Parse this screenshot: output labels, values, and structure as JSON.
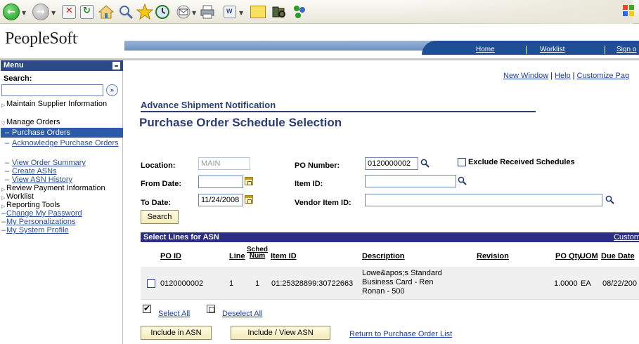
{
  "header": {
    "logo": "PeopleSoft",
    "logo_mark": ".",
    "links": [
      "Home",
      "Worklist",
      "Sign o"
    ]
  },
  "menu": {
    "title": "Menu",
    "search_label": "Search:",
    "search_go": "»",
    "items": [
      {
        "label": "Maintain Supplier Information",
        "type": "folder-collapsed"
      },
      {
        "label": "Manage Orders",
        "type": "folder-expanded"
      },
      {
        "label": "Purchase Orders",
        "type": "sub-active"
      },
      {
        "label": "Acknowledge Purchase Orders",
        "type": "sub"
      },
      {
        "label": "View Order Summary",
        "type": "sub"
      },
      {
        "label": "Create ASNs",
        "type": "sub"
      },
      {
        "label": "View ASN History",
        "type": "sub"
      },
      {
        "label": "Review Payment Information",
        "type": "folder-collapsed"
      },
      {
        "label": "Worklist",
        "type": "folder-collapsed"
      },
      {
        "label": "Reporting Tools",
        "type": "folder-collapsed"
      },
      {
        "label": "Change My Password",
        "type": "link"
      },
      {
        "label": "My Personalizations",
        "type": "link"
      },
      {
        "label": "My System Profile",
        "type": "link"
      }
    ]
  },
  "content": {
    "top_links": [
      "New Window",
      "Help",
      "Customize Pag"
    ],
    "breadcrumb": "Advance Shipment Notification",
    "title": "Purchase Order Schedule Selection",
    "fields": {
      "location_label": "Location:",
      "location_value": "MAIN",
      "from_date_label": "From Date:",
      "from_date_value": "",
      "to_date_label": "To Date:",
      "to_date_value": "11/24/2008",
      "po_number_label": "PO Number:",
      "po_number_value": "0120000002",
      "item_id_label": "Item ID:",
      "item_id_value": "",
      "vendor_item_id_label": "Vendor Item ID:",
      "vendor_item_id_value": "",
      "exclude_label": "Exclude Received Schedules"
    },
    "search_button": "Search"
  },
  "grid": {
    "title": "Select Lines for ASN",
    "customize": "Custom",
    "columns": {
      "po_id": "PO ID",
      "line": "Line",
      "sched_num_1": "Sched",
      "sched_num_2": "Num",
      "item_id": "Item ID",
      "description": "Description",
      "revision": "Revision",
      "po_qty": "PO Qty",
      "uom": "UOM",
      "due_date": "Due Date"
    },
    "rows": [
      {
        "po_id": "0120000002",
        "line": "1",
        "sched_num": "1",
        "item_id": "01:25328899:30722663",
        "description": "Lowe&apos;s Standard Business Card - Ren Ronan - 500",
        "revision": "",
        "po_qty": "1.0000",
        "uom": "EA",
        "due_date": "08/22/200"
      }
    ]
  },
  "actions": {
    "select_all": "Select All",
    "deselect_all": "Deselect All",
    "include_in_asn": "Include in ASN",
    "include_view_asn": "Include / View ASN",
    "return_link": "Return to Purchase Order List"
  }
}
